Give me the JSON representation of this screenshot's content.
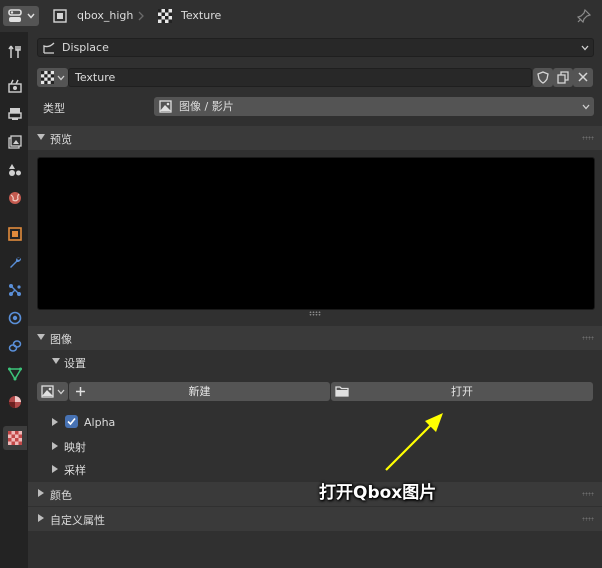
{
  "header": {
    "object_name": "qbox_high",
    "texture_name": "Texture"
  },
  "modifier": {
    "name": "Displace"
  },
  "texture": {
    "name": "Texture",
    "type_label": "类型",
    "type_value": "图像 / 影片"
  },
  "preview": {
    "title": "预览"
  },
  "image_panel": {
    "title": "图像",
    "settings_title": "设置",
    "new_label": "新建",
    "open_label": "打开",
    "alpha_label": "Alpha",
    "alpha_checked": true,
    "mapping_title": "映射",
    "sampling_title": "采样"
  },
  "colors_panel": {
    "title": "颜色"
  },
  "custom_props_panel": {
    "title": "自定义属性"
  },
  "annotation": {
    "text": "打开Qbox图片",
    "color": "#ffff00"
  },
  "sidebar": {
    "tabs": [
      "tool-icon",
      "render-icon",
      "output-icon",
      "view-layer-icon",
      "scene-icon",
      "world-icon",
      "object-icon",
      "modifier-icon",
      "particles-icon",
      "physics-icon",
      "constraints-icon",
      "data-icon",
      "material-icon",
      "texture-icon"
    ],
    "active": "texture-icon"
  },
  "theme": {
    "accent": "#4772b3",
    "background": "#303030"
  }
}
